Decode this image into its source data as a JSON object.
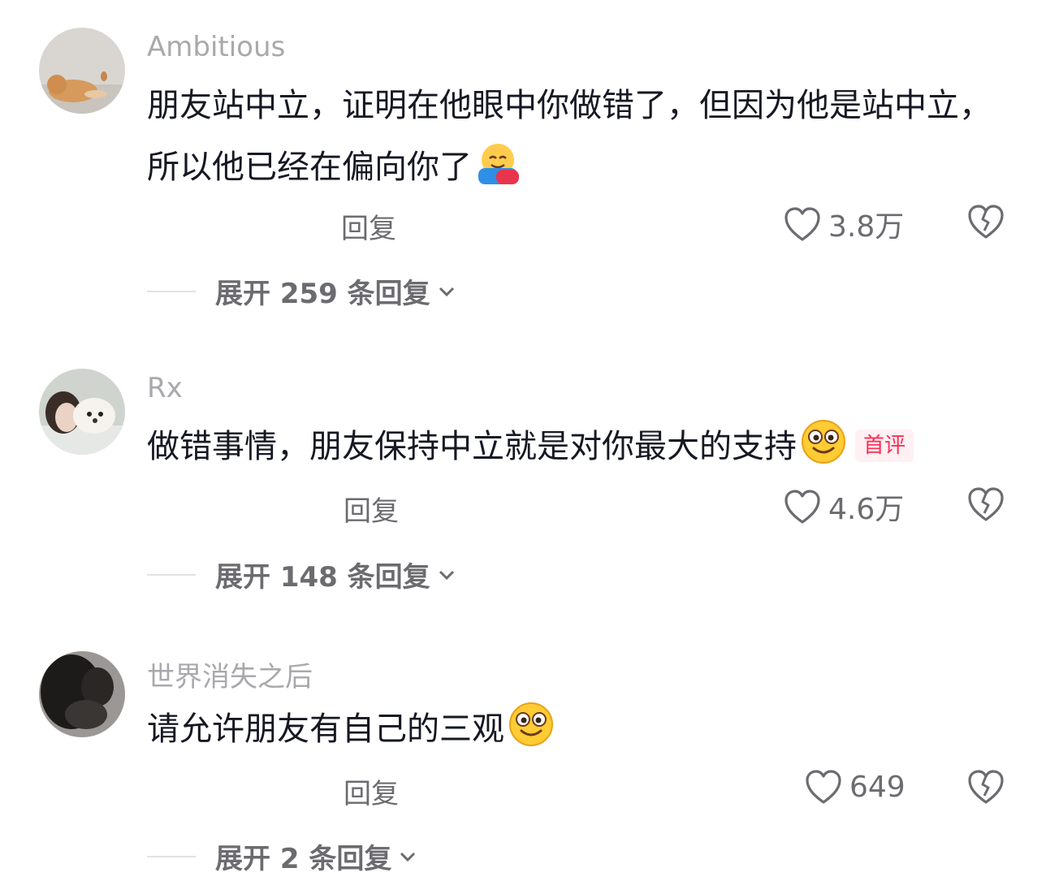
{
  "comments": [
    {
      "username": "Ambitious",
      "text": "朋友站中立，证明在他眼中你做错了，但因为他是站中立，所以他已经在偏向你了",
      "emoji": "hugging-face-emoji",
      "reply_label": "回复",
      "likes": "3.8万",
      "expand_label": "展开 259 条回复"
    },
    {
      "username": "Rx",
      "text": "做错事情，朋友保持中立就是对你最大的支持",
      "emoji": "smiling-face-emoji",
      "badge": "首评",
      "reply_label": "回复",
      "likes": "4.6万",
      "expand_label": "展开 148 条回复"
    },
    {
      "username": "世界消失之后",
      "text": "请允许朋友有自己的三观",
      "emoji": "smiling-face-emoji",
      "reply_label": "回复",
      "likes": "649",
      "expand_label": "展开 2 条回复"
    }
  ],
  "colors": {
    "username": "#a9a9ad",
    "text": "#161823",
    "secondary": "#6b6b70",
    "badge": "#fe2c55"
  }
}
